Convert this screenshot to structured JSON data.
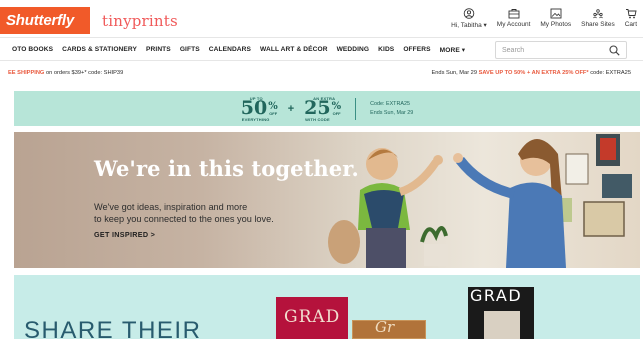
{
  "header": {
    "brand": "Shutterfly",
    "partner": "tinyprints",
    "utility": [
      {
        "label": "Hi, Tabitha ▾",
        "icon": "user-icon"
      },
      {
        "label": "My Account",
        "icon": "briefcase-icon"
      },
      {
        "label": "My Photos",
        "icon": "photo-icon"
      },
      {
        "label": "Share Sites",
        "icon": "share-sites-icon"
      },
      {
        "label": "Cart",
        "icon": "cart-icon"
      }
    ]
  },
  "nav": {
    "items": [
      "OTO BOOKS",
      "CARDS & STATIONERY",
      "PRINTS",
      "GIFTS",
      "CALENDARS",
      "WALL ART & DÉCOR",
      "WEDDING",
      "KIDS",
      "OFFERS",
      "MORE ▾"
    ],
    "search_placeholder": "Search"
  },
  "promo": {
    "left_bold": "EE SHIPPING",
    "left_rest": " on orders $39+* code: SHIP39",
    "right_prefix": "Ends Sun, Mar 29 ",
    "right_bold": "SAVE UP TO 50% + AN EXTRA 25% OFF*",
    "right_code": " code: EXTRA25"
  },
  "offer": {
    "first_top": "UP TO",
    "first_number": "50",
    "first_pct": "%",
    "first_off": "OFF",
    "first_bottom": "EVERYTHING",
    "plus": "+",
    "second_top": "AN EXTRA",
    "second_number": "25",
    "second_pct": "%",
    "second_off": "OFF",
    "second_bottom": "WITH CODE",
    "code_line": "Code: EXTRA25",
    "ends_line": "Ends Sun, Mar 29"
  },
  "hero": {
    "title": "We're in this together.",
    "body_line1": "We've got ideas, inspiration and more",
    "body_line2": "to keep you connected to the ones you love.",
    "cta": "GET INSPIRED >"
  },
  "lower": {
    "headline": "SHARE THEIR",
    "book_text": "GRAD",
    "card_text": "Gr",
    "dark_text": "GRAD"
  },
  "colors": {
    "brand_orange": "#f15a29",
    "offer_bg": "#b7e5d8",
    "offer_text": "#21665c",
    "promo_red": "#e95a3f",
    "lower_bg": "#c7ece8"
  }
}
